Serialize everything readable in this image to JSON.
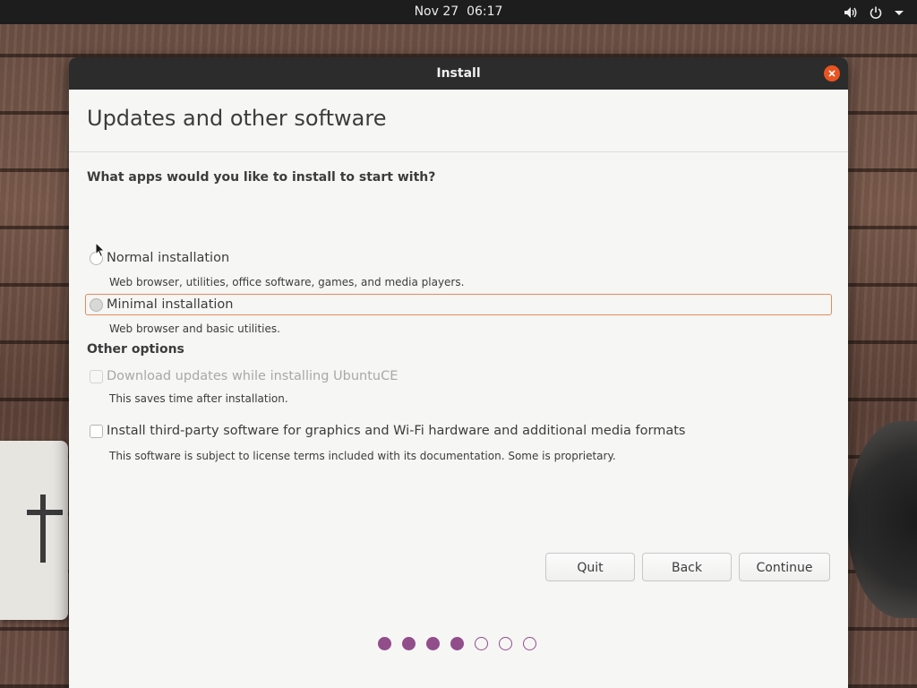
{
  "topbar": {
    "date": "Nov 27",
    "time": "06:17",
    "icons": [
      "volume-icon",
      "power-icon",
      "dropdown-arrow-icon"
    ]
  },
  "window": {
    "title": "Install",
    "close_icon": "close-icon",
    "page_title": "Updates and other software"
  },
  "apps_section": {
    "heading": "What apps would you like to install to start with?",
    "options": [
      {
        "label": "Normal installation",
        "description": "Web browser, utilities, office software, games, and media players.",
        "selected": false
      },
      {
        "label": "Minimal installation",
        "description": "Web browser and basic utilities.",
        "selected": false,
        "focused": true
      }
    ]
  },
  "other_section": {
    "heading": "Other options",
    "options": [
      {
        "label": "Download updates while installing UbuntuCE",
        "description": "This saves time after installation.",
        "checked": false,
        "enabled": false
      },
      {
        "label": "Install third-party software for graphics and Wi-Fi hardware and additional media formats",
        "description": "This software is subject to license terms included with its documentation. Some is proprietary.",
        "checked": false,
        "enabled": true
      }
    ]
  },
  "buttons": {
    "quit": "Quit",
    "back": "Back",
    "continue": "Continue"
  },
  "progress": {
    "total_steps": 7,
    "completed_steps": 4
  },
  "colors": {
    "accent": "#e95420",
    "progress": "#924d8b",
    "titlebar": "#2c2c2c",
    "panel": "#1d1d1d"
  }
}
